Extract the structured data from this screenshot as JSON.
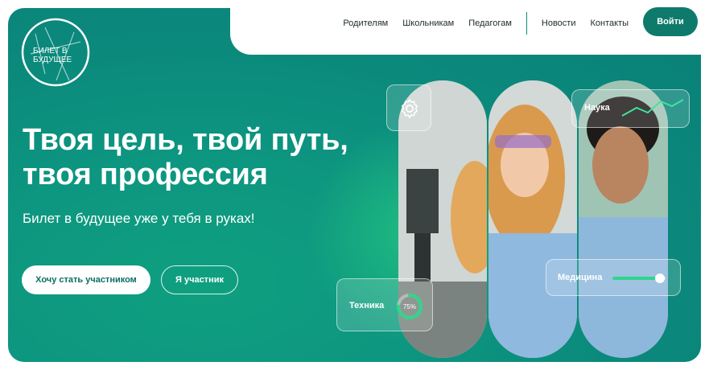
{
  "header": {
    "nav": [
      "Родителям",
      "Школьникам",
      "Педагогам",
      "Новости",
      "Контакты"
    ],
    "login_label": "Войти"
  },
  "logo": {
    "line1": "БИЛЕТ В",
    "line2": "БУДУЩЕЕ"
  },
  "hero": {
    "headline_line1": "Твоя цель, твой путь,",
    "headline_line2": "твоя профессия",
    "subline": "Билет в будущее уже у тебя в руках!",
    "primary_cta": "Хочу стать участником",
    "secondary_cta": "Я участник"
  },
  "cards": {
    "science": "Наука",
    "medicine": "Медицина",
    "tech": "Техника",
    "tech_progress": 0.75,
    "tech_progress_label": "75%",
    "medicine_level": 0.9
  },
  "colors": {
    "brand": "#0e7a6c",
    "accent_green": "#2fd68c"
  },
  "icons": {
    "settings": "gear-icon"
  }
}
